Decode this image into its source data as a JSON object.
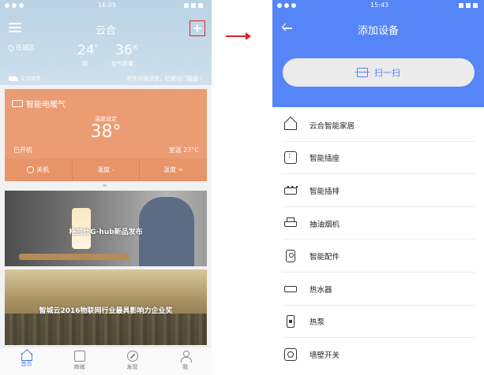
{
  "left": {
    "status": {
      "time": "16:05"
    },
    "header": {
      "title": "云合",
      "menu_icon": "menu-icon",
      "add_icon": "plus-icon"
    },
    "weather": {
      "location": "任城区",
      "temperature": "24",
      "temperature_unit": "°",
      "condition": "晴",
      "aqi": "36",
      "aqi_level": "优",
      "aqi_label": "空气质量"
    },
    "steps": "2356步",
    "env_text": "室外环境适宜，赶紧出门遛遛 ›",
    "heater": {
      "name": "智能电暖气",
      "set_label": "温度设定",
      "set_temp": "38°",
      "state": "已开机",
      "room_temp": "室温 27°C",
      "controls": [
        "关机",
        "温度 -",
        "温度 +"
      ]
    },
    "banners": [
      {
        "text": "格兰仕G-hub新品发布"
      },
      {
        "text": "智城云2016物联网行业最具影响力企业奖"
      }
    ],
    "tabs": [
      {
        "label": "首页",
        "icon": "home-icon",
        "active": true
      },
      {
        "label": "商城",
        "icon": "shop-icon",
        "active": false
      },
      {
        "label": "发现",
        "icon": "compass-icon",
        "active": false
      },
      {
        "label": "我",
        "icon": "profile-icon",
        "active": false
      }
    ]
  },
  "right": {
    "status": {
      "time": "15:43"
    },
    "header": {
      "title": "添加设备",
      "back_icon": "back-arrow-icon"
    },
    "scan_label": "扫一扫",
    "devices": [
      {
        "label": "云合智能家居",
        "icon": "house-icon"
      },
      {
        "label": "智能插座",
        "icon": "socket-icon"
      },
      {
        "label": "智能插排",
        "icon": "power-strip-icon"
      },
      {
        "label": "抽油烟机",
        "icon": "range-hood-icon"
      },
      {
        "label": "智能配件",
        "icon": "accessory-icon"
      },
      {
        "label": "热水器",
        "icon": "water-heater-icon"
      },
      {
        "label": "热泵",
        "icon": "heat-pump-icon"
      },
      {
        "label": "墙壁开关",
        "icon": "wall-switch-icon"
      }
    ]
  },
  "colors": {
    "brand_blue": "#5585f6",
    "heater_orange": "#ec9c72",
    "highlight_red": "#e02020",
    "weather_bg": "#b9d2e4"
  }
}
